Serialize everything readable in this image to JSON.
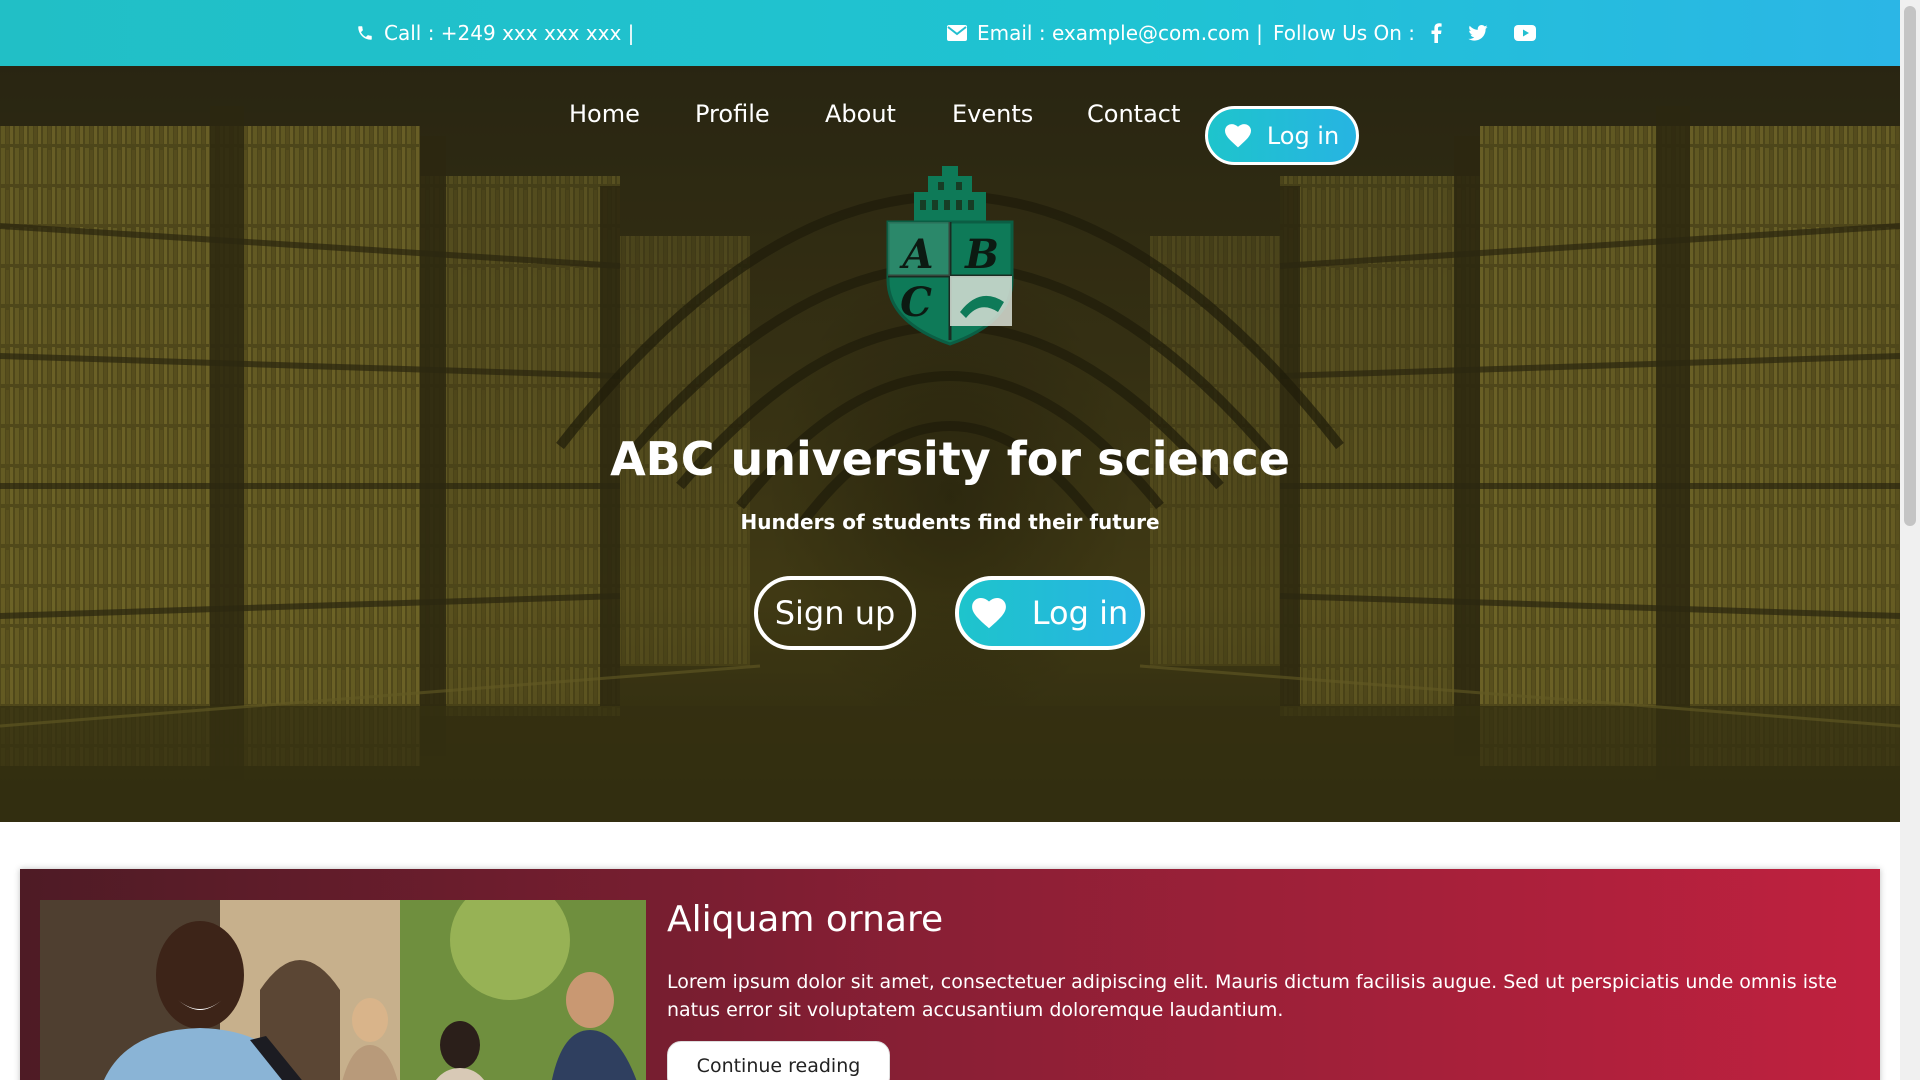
{
  "topbar": {
    "call_text": "Call : +249 xxx xxx xxx |",
    "email_text": "Email : example@com.com |",
    "follow_text": "Follow Us On :",
    "icons": [
      "phone-icon",
      "envelope-icon",
      "facebook-icon",
      "twitter-icon",
      "youtube-icon"
    ]
  },
  "nav": {
    "items": [
      {
        "label": "Home"
      },
      {
        "label": "Profile"
      },
      {
        "label": "About"
      },
      {
        "label": "Events"
      },
      {
        "label": "Contact"
      }
    ],
    "login_label": "Log in"
  },
  "hero": {
    "crest_letters": [
      "A",
      "B",
      "C"
    ],
    "title": "ABC university for science",
    "subtitle": "Hunders of students find their future",
    "signup_label": "Sign up",
    "login_label": "Log in"
  },
  "card": {
    "title": "Aliquam ornare",
    "text": "Lorem ipsum dolor sit amet, consectetuer adipiscing elit. Mauris dictum facilisis augue. Sed ut perspiciatis unde omnis iste natus error sit voluptatem accusantium doloremque laudantium.",
    "button_label": "Continue reading"
  },
  "colors": {
    "topbar_start": "#21bfc6",
    "topbar_end": "#2bb6e6",
    "crest_green": "#0e7a58",
    "card_start": "#4e1b25",
    "card_end": "#c0213f"
  }
}
